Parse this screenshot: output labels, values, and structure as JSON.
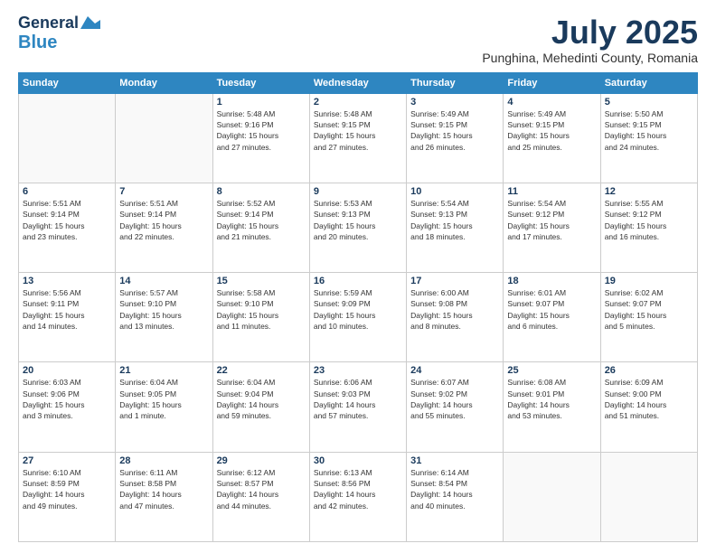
{
  "header": {
    "logo_line1": "General",
    "logo_line2": "Blue",
    "month": "July 2025",
    "location": "Punghina, Mehedinti County, Romania"
  },
  "weekdays": [
    "Sunday",
    "Monday",
    "Tuesday",
    "Wednesday",
    "Thursday",
    "Friday",
    "Saturday"
  ],
  "weeks": [
    [
      {
        "day": "",
        "info": ""
      },
      {
        "day": "",
        "info": ""
      },
      {
        "day": "1",
        "info": "Sunrise: 5:48 AM\nSunset: 9:16 PM\nDaylight: 15 hours\nand 27 minutes."
      },
      {
        "day": "2",
        "info": "Sunrise: 5:48 AM\nSunset: 9:15 PM\nDaylight: 15 hours\nand 27 minutes."
      },
      {
        "day": "3",
        "info": "Sunrise: 5:49 AM\nSunset: 9:15 PM\nDaylight: 15 hours\nand 26 minutes."
      },
      {
        "day": "4",
        "info": "Sunrise: 5:49 AM\nSunset: 9:15 PM\nDaylight: 15 hours\nand 25 minutes."
      },
      {
        "day": "5",
        "info": "Sunrise: 5:50 AM\nSunset: 9:15 PM\nDaylight: 15 hours\nand 24 minutes."
      }
    ],
    [
      {
        "day": "6",
        "info": "Sunrise: 5:51 AM\nSunset: 9:14 PM\nDaylight: 15 hours\nand 23 minutes."
      },
      {
        "day": "7",
        "info": "Sunrise: 5:51 AM\nSunset: 9:14 PM\nDaylight: 15 hours\nand 22 minutes."
      },
      {
        "day": "8",
        "info": "Sunrise: 5:52 AM\nSunset: 9:14 PM\nDaylight: 15 hours\nand 21 minutes."
      },
      {
        "day": "9",
        "info": "Sunrise: 5:53 AM\nSunset: 9:13 PM\nDaylight: 15 hours\nand 20 minutes."
      },
      {
        "day": "10",
        "info": "Sunrise: 5:54 AM\nSunset: 9:13 PM\nDaylight: 15 hours\nand 18 minutes."
      },
      {
        "day": "11",
        "info": "Sunrise: 5:54 AM\nSunset: 9:12 PM\nDaylight: 15 hours\nand 17 minutes."
      },
      {
        "day": "12",
        "info": "Sunrise: 5:55 AM\nSunset: 9:12 PM\nDaylight: 15 hours\nand 16 minutes."
      }
    ],
    [
      {
        "day": "13",
        "info": "Sunrise: 5:56 AM\nSunset: 9:11 PM\nDaylight: 15 hours\nand 14 minutes."
      },
      {
        "day": "14",
        "info": "Sunrise: 5:57 AM\nSunset: 9:10 PM\nDaylight: 15 hours\nand 13 minutes."
      },
      {
        "day": "15",
        "info": "Sunrise: 5:58 AM\nSunset: 9:10 PM\nDaylight: 15 hours\nand 11 minutes."
      },
      {
        "day": "16",
        "info": "Sunrise: 5:59 AM\nSunset: 9:09 PM\nDaylight: 15 hours\nand 10 minutes."
      },
      {
        "day": "17",
        "info": "Sunrise: 6:00 AM\nSunset: 9:08 PM\nDaylight: 15 hours\nand 8 minutes."
      },
      {
        "day": "18",
        "info": "Sunrise: 6:01 AM\nSunset: 9:07 PM\nDaylight: 15 hours\nand 6 minutes."
      },
      {
        "day": "19",
        "info": "Sunrise: 6:02 AM\nSunset: 9:07 PM\nDaylight: 15 hours\nand 5 minutes."
      }
    ],
    [
      {
        "day": "20",
        "info": "Sunrise: 6:03 AM\nSunset: 9:06 PM\nDaylight: 15 hours\nand 3 minutes."
      },
      {
        "day": "21",
        "info": "Sunrise: 6:04 AM\nSunset: 9:05 PM\nDaylight: 15 hours\nand 1 minute."
      },
      {
        "day": "22",
        "info": "Sunrise: 6:04 AM\nSunset: 9:04 PM\nDaylight: 14 hours\nand 59 minutes."
      },
      {
        "day": "23",
        "info": "Sunrise: 6:06 AM\nSunset: 9:03 PM\nDaylight: 14 hours\nand 57 minutes."
      },
      {
        "day": "24",
        "info": "Sunrise: 6:07 AM\nSunset: 9:02 PM\nDaylight: 14 hours\nand 55 minutes."
      },
      {
        "day": "25",
        "info": "Sunrise: 6:08 AM\nSunset: 9:01 PM\nDaylight: 14 hours\nand 53 minutes."
      },
      {
        "day": "26",
        "info": "Sunrise: 6:09 AM\nSunset: 9:00 PM\nDaylight: 14 hours\nand 51 minutes."
      }
    ],
    [
      {
        "day": "27",
        "info": "Sunrise: 6:10 AM\nSunset: 8:59 PM\nDaylight: 14 hours\nand 49 minutes."
      },
      {
        "day": "28",
        "info": "Sunrise: 6:11 AM\nSunset: 8:58 PM\nDaylight: 14 hours\nand 47 minutes."
      },
      {
        "day": "29",
        "info": "Sunrise: 6:12 AM\nSunset: 8:57 PM\nDaylight: 14 hours\nand 44 minutes."
      },
      {
        "day": "30",
        "info": "Sunrise: 6:13 AM\nSunset: 8:56 PM\nDaylight: 14 hours\nand 42 minutes."
      },
      {
        "day": "31",
        "info": "Sunrise: 6:14 AM\nSunset: 8:54 PM\nDaylight: 14 hours\nand 40 minutes."
      },
      {
        "day": "",
        "info": ""
      },
      {
        "day": "",
        "info": ""
      }
    ]
  ]
}
